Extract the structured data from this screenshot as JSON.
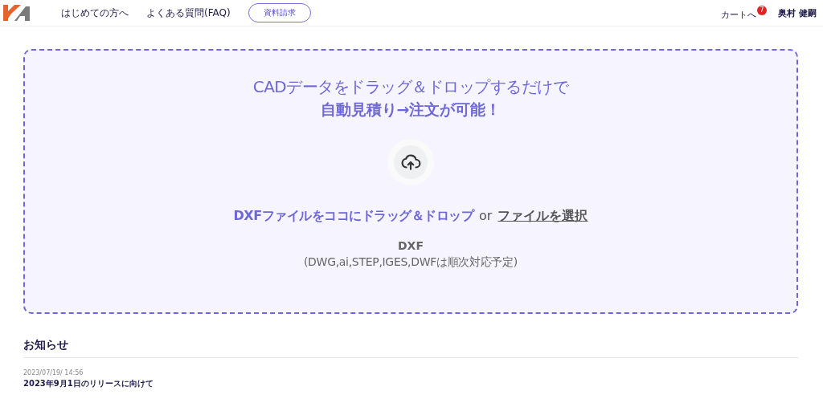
{
  "header": {
    "nav": [
      "はじめての方へ",
      "よくある質問(FAQ)"
    ],
    "request_button": "資料請求",
    "cart": {
      "label": "カートへ",
      "count": "7"
    },
    "user": "奥村 健嗣"
  },
  "dropzone": {
    "headline": "CADデータをドラッグ＆ドロップするだけで",
    "subheadline": "自動見積り→注文が可能！",
    "prompt": "DXFファイルをココにドラッグ＆ドロップ",
    "or": "or",
    "select_link": "ファイルを選択",
    "format": "DXF",
    "format_note": "(DWG,ai,STEP,IGES,DWFは順次対応予定)"
  },
  "news": {
    "title": "お知らせ",
    "items": [
      {
        "date": "2023/07/19/ 14:56",
        "title": "2023年9月1日のリリースに向けて"
      }
    ]
  }
}
